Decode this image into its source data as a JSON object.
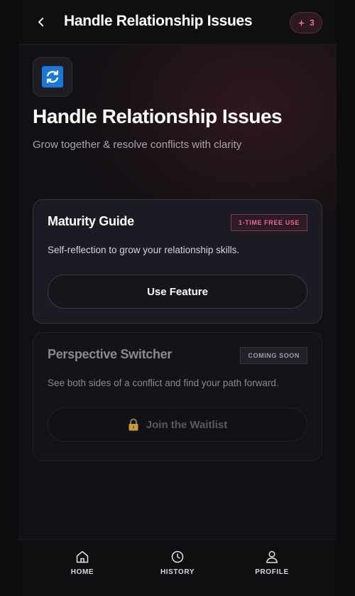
{
  "header": {
    "title": "Handle Relationship Issues",
    "credits_icon": "sparkle-icon",
    "credits_count": "3"
  },
  "hero": {
    "icon": "refresh-arrows-icon",
    "title": "Handle Relationship Issues",
    "subtitle": "Grow together & resolve conflicts with clarity"
  },
  "features": [
    {
      "title": "Maturity Guide",
      "badge": "1-TIME FREE USE",
      "description": "Self-reflection to grow your relationship skills.",
      "button_label": "Use Feature"
    },
    {
      "title": "Perspective Switcher",
      "badge": "COMING SOON",
      "description": "See both sides of a conflict and find your path forward.",
      "button_icon": "lock-icon",
      "button_label": "Join the Waitlist"
    }
  ],
  "nav": {
    "items": [
      {
        "label": "HOME",
        "icon": "home-icon"
      },
      {
        "label": "HISTORY",
        "icon": "clock-icon"
      },
      {
        "label": "PROFILE",
        "icon": "user-icon"
      }
    ]
  },
  "colors": {
    "accent_pink": "#e46a98",
    "app_icon_blue": "#1a79d8",
    "background": "#121014"
  }
}
